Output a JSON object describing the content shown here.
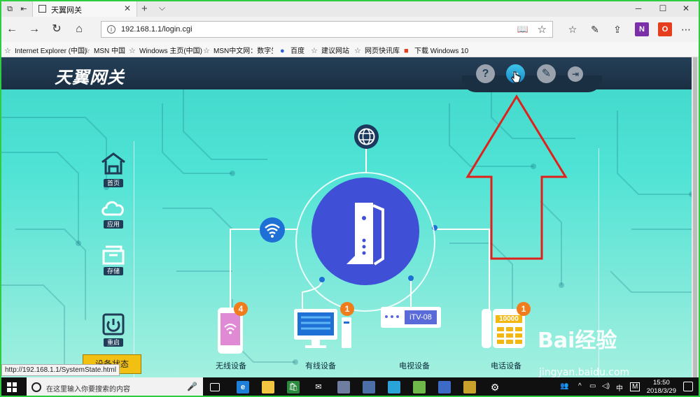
{
  "browser": {
    "tab_title": "天翼网关",
    "url": "192.168.1.1/login.cgi",
    "favorites": [
      {
        "label": "Internet Explorer (中国)"
      },
      {
        "label": "MSN 中国"
      },
      {
        "label": "Windows 主页(中国)"
      },
      {
        "label": "MSN中文网：数字生活"
      },
      {
        "label": "百度"
      },
      {
        "label": "建议网站"
      },
      {
        "label": "网页快讯库"
      },
      {
        "label": "下载 Windows 10"
      }
    ]
  },
  "router": {
    "logo": "天翼网关",
    "header_icons": [
      "help-icon",
      "network-status-icon",
      "settings-wrench-icon",
      "logout-icon"
    ],
    "nav": [
      {
        "label": "首页",
        "icon": "home-icon"
      },
      {
        "label": "应用",
        "icon": "cloud-icon"
      },
      {
        "label": "存储",
        "icon": "storage-icon"
      },
      {
        "label": "重启",
        "icon": "power-icon"
      }
    ],
    "restart_button": "设备状态",
    "devices": [
      {
        "label": "无线设备",
        "count": "4"
      },
      {
        "label": "有线设备",
        "count": "1"
      },
      {
        "label": "电视设备",
        "tag": "iTV-08"
      },
      {
        "label": "电话设备",
        "count": "1",
        "number": "10000"
      }
    ]
  },
  "status_bar_url": "http://192.168.1.1/SystemState.html",
  "watermark": {
    "brand": "Bai经验",
    "site": "jingyan.baidu.com"
  },
  "taskbar": {
    "search_placeholder": "在这里输入你要搜索的内容",
    "time": "15:50",
    "date": "2018/3/29",
    "ime": "中",
    "ime_mode": "M"
  },
  "colors": {
    "accent": "#3f4fd6",
    "badge": "#f07c1b",
    "header": "#1b2f43",
    "frame": "#2ecc40",
    "annotation": "#e0201b"
  }
}
